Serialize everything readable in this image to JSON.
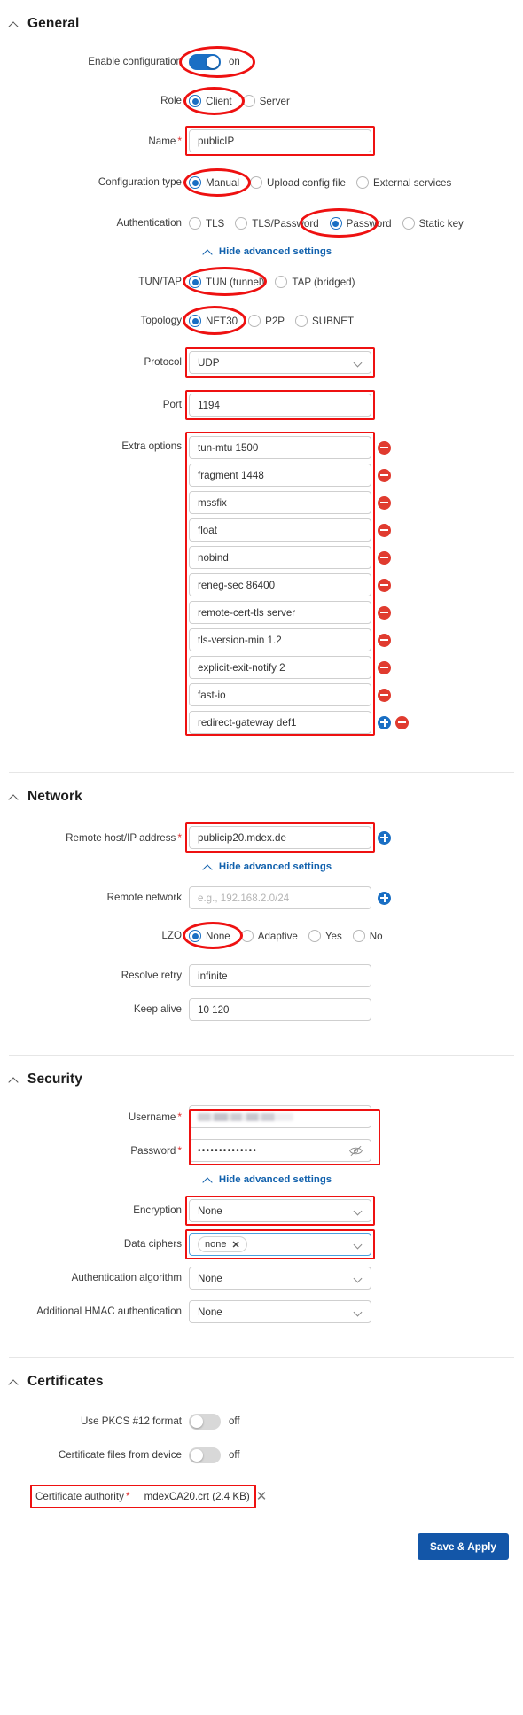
{
  "sections": {
    "general": {
      "title": "General",
      "enable_configuration": {
        "label": "Enable configuration",
        "state": "on"
      },
      "role": {
        "label": "Role",
        "options": [
          "Client",
          "Server"
        ],
        "selected": "Client"
      },
      "name": {
        "label": "Name",
        "value": "publicIP",
        "required": "*"
      },
      "configuration_type": {
        "label": "Configuration type",
        "options": [
          "Manual",
          "Upload config file",
          "External services"
        ],
        "selected": "Manual"
      },
      "authentication": {
        "label": "Authentication",
        "options": [
          "TLS",
          "TLS/Password",
          "Password",
          "Static key"
        ],
        "selected": "Password"
      },
      "advanced_toggle": "Hide advanced settings",
      "tun_tap": {
        "label": "TUN/TAP",
        "options": [
          "TUN (tunnel)",
          "TAP (bridged)"
        ],
        "selected": "TUN (tunnel)"
      },
      "topology": {
        "label": "Topology",
        "options": [
          "NET30",
          "P2P",
          "SUBNET"
        ],
        "selected": "NET30"
      },
      "protocol": {
        "label": "Protocol",
        "value": "UDP"
      },
      "port": {
        "label": "Port",
        "value": "1194"
      },
      "extra_options": {
        "label": "Extra options",
        "values": [
          "tun-mtu 1500",
          "fragment 1448",
          "mssfix",
          "float",
          "nobind",
          "reneg-sec 86400",
          "remote-cert-tls server",
          "tls-version-min 1.2",
          "explicit-exit-notify 2",
          "fast-io",
          "redirect-gateway def1"
        ]
      }
    },
    "network": {
      "title": "Network",
      "remote_host": {
        "label": "Remote host/IP address",
        "value": "publicip20.mdex.de",
        "required": "*"
      },
      "advanced_toggle": "Hide advanced settings",
      "remote_network": {
        "label": "Remote network",
        "value": "",
        "placeholder": "e.g., 192.168.2.0/24"
      },
      "lzo": {
        "label": "LZO",
        "options": [
          "None",
          "Adaptive",
          "Yes",
          "No"
        ],
        "selected": "None"
      },
      "resolve_retry": {
        "label": "Resolve retry",
        "value": "infinite"
      },
      "keep_alive": {
        "label": "Keep alive",
        "value": "10 120"
      }
    },
    "security": {
      "title": "Security",
      "username": {
        "label": "Username",
        "value": "",
        "required": "*"
      },
      "password": {
        "label": "Password",
        "value": "••••••••••••••",
        "required": "*"
      },
      "advanced_toggle": "Hide advanced settings",
      "encryption": {
        "label": "Encryption",
        "value": "None"
      },
      "data_ciphers": {
        "label": "Data ciphers",
        "chips": [
          "none"
        ]
      },
      "auth_algorithm": {
        "label": "Authentication algorithm",
        "value": "None"
      },
      "additional_hmac": {
        "label": "Additional HMAC authentication",
        "value": "None"
      }
    },
    "certificates": {
      "title": "Certificates",
      "use_pkcs12": {
        "label": "Use PKCS #12 format",
        "state": "off"
      },
      "cert_files_from_device": {
        "label": "Certificate files from device",
        "state": "off"
      },
      "certificate_authority": {
        "label": "Certificate authority",
        "file": "mdexCA20.crt (2.4 KB)",
        "required": "*"
      }
    }
  },
  "footer": {
    "save_label": "Save & Apply"
  },
  "colors": {
    "accent_blue": "#1a6fc4",
    "primary_button": "#1356a8",
    "annotation_red": "#ee1111",
    "required_red": "#e03030",
    "remove_red": "#e03b2f",
    "link_blue": "#1161ad"
  }
}
